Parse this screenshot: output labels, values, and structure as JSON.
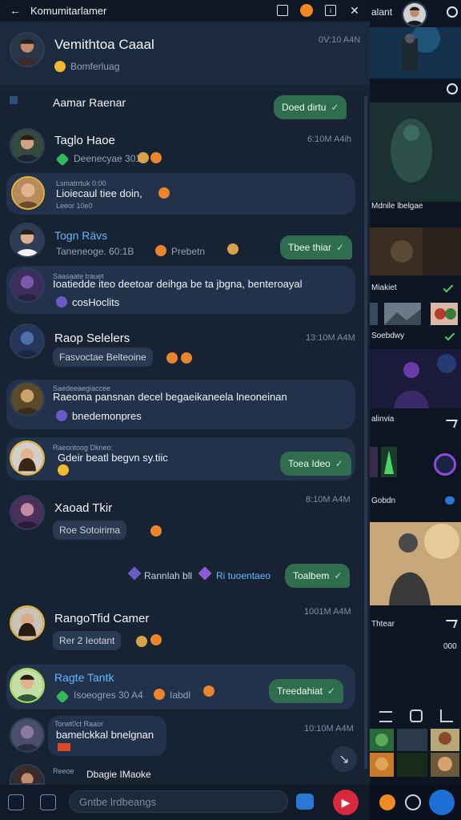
{
  "topbar": {
    "title": "Komumitarlamer"
  },
  "pinned": {
    "name": "Vemithtoa Caaal",
    "sub": "Bomferluag",
    "time": "0V:10 A4N"
  },
  "messages": [
    {
      "name": "Aamar Raenar",
      "reply": "Doed dirtu"
    },
    {
      "name": "Taglo Haoe",
      "sub": "Deenecyae 3010",
      "time": "6:10M A4ih"
    },
    {
      "small": "Lsmatrrtuk 0:00",
      "text": "Lioiecaul tiee doin,",
      "small2": "Leeor 10e0"
    },
    {
      "name": "Togn Rävs",
      "sub": "Taneneoge. 60:1B",
      "sub2": "Prebetn",
      "reply": "Tbee thiar"
    },
    {
      "small": "Saasaate trauet",
      "text": "Ioatiedde iteo deetoar deihga be ta jbgna, benteroayal",
      "text2": "cosHoclits"
    },
    {
      "name": "Raop Selelers",
      "chip": "Fasvoctae Belteoine",
      "time": "13:10M A4M"
    },
    {
      "small": "Saedeeaegiaccee",
      "text": "Raeoma pansnan decel begaeikaneela lneoneinan",
      "text2": "bnedemonpres"
    },
    {
      "small": "Raeontoog Dkneo:",
      "text": "Gdeir beatl begvn sy.tiic",
      "reply": "Toea Ideo"
    },
    {
      "name": "Xaoad Tkir",
      "chip": "Roe Sotoirima",
      "time": "8:10M A4M"
    },
    {
      "l1": "Rannlah bll",
      "l2": "Ri tuoentaeo",
      "reply": "Toalbem"
    },
    {
      "name": "RangoTfid Camer",
      "chip": "Rer 2 Ieotant",
      "time": "1001M A4M"
    },
    {
      "name": "Ragte Tantk",
      "sub": "Isoeogres 30 A4",
      "sub2": "Iabdl",
      "reply": "Treedahiat"
    },
    {
      "small": "Tonet0ct Raaor",
      "text": "bamelckkal bnelgnan",
      "time": "10:10M A4M"
    },
    {
      "small": "Reeoe",
      "text": "Dbagie IMaoke"
    }
  ],
  "composer": {
    "placeholder": "Gntbe lrdbeangs"
  },
  "panel": {
    "title": "alant",
    "captions": [
      "Mdnile lbelgae",
      "Miakiet",
      "Soebdwy",
      "alinvia",
      "Gobdn",
      "Thtear"
    ],
    "count": "000"
  },
  "colors": {
    "bg": "#172233",
    "bubble": "#22324a",
    "reply": "#2f6d4e",
    "accent": "#f08a24",
    "active": "#1e6fd6"
  }
}
